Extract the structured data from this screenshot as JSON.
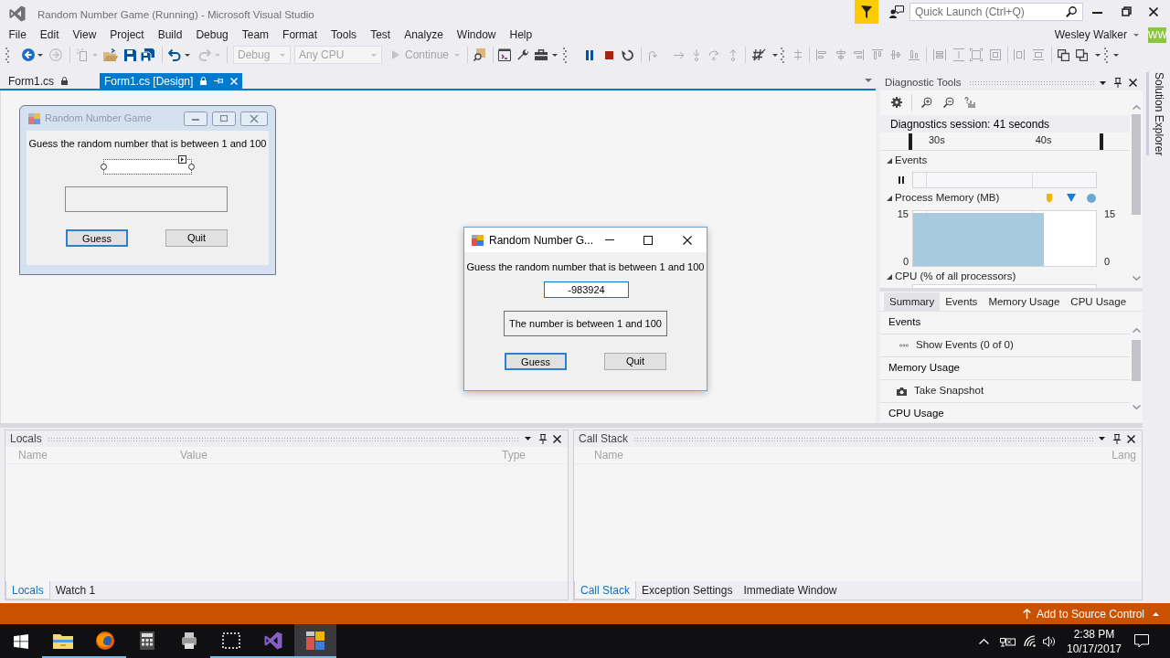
{
  "window": {
    "title": "Random Number Game (Running) - Microsoft Visual Studio",
    "quick_launch": {
      "placeholder": "Quick Launch (Ctrl+Q)"
    }
  },
  "menu": [
    "File",
    "Edit",
    "View",
    "Project",
    "Build",
    "Debug",
    "Team",
    "Format",
    "Tools",
    "Test",
    "Analyze",
    "Window",
    "Help"
  ],
  "account": {
    "name": "Wesley Walker",
    "initials": "WW"
  },
  "toolbar": {
    "configuration": {
      "value": "Debug",
      "disabled": true
    },
    "platform": {
      "value": "Any CPU",
      "disabled": true
    },
    "continue": {
      "label": "Continue",
      "disabled": true
    }
  },
  "document_tabs": [
    {
      "label": "Form1.cs",
      "selected": false
    },
    {
      "label": "Form1.cs [Design]",
      "selected": true
    }
  ],
  "designer_form": {
    "title": "Random Number Game",
    "prompt": "Guess the random number that is between 1 and 100",
    "buttons": [
      {
        "label": "Guess",
        "focused": true
      },
      {
        "label": "Quit",
        "focused": false
      }
    ]
  },
  "running_dialog": {
    "title": "Random Number G...",
    "prompt": "Guess the random number that is between 1 and 100",
    "input": "-983924",
    "message": "The number is between 1 and 100",
    "buttons": [
      {
        "label": "Guess",
        "focused": true
      },
      {
        "label": "Quit",
        "focused": false
      }
    ]
  },
  "diagnostic_tools": {
    "title": "Diagnostic Tools",
    "session": "Diagnostics session: 41 seconds",
    "timeline": [
      "30s",
      "40s"
    ],
    "events_label": "Events",
    "memory": {
      "label": "Process Memory (MB)",
      "left_axis": [
        "15",
        "0"
      ],
      "right_axis": [
        "15",
        "0"
      ]
    },
    "cpu_label": "CPU (% of all processors)",
    "tabs": [
      {
        "label": "Summary",
        "selected": true
      },
      {
        "label": "Events",
        "selected": false
      },
      {
        "label": "Memory Usage",
        "selected": false
      },
      {
        "label": "CPU Usage",
        "selected": false
      }
    ],
    "sections": [
      {
        "heading": "Events",
        "action": {
          "kind": "events",
          "label": "Show Events (0 of 0)"
        }
      },
      {
        "heading": "Memory Usage",
        "action": {
          "kind": "snapshot",
          "label": "Take Snapshot"
        }
      },
      {
        "heading": "CPU Usage"
      }
    ]
  },
  "side_tab": "Solution Explorer",
  "locals": {
    "title": "Locals",
    "columns": [
      "Name",
      "Value",
      "Type"
    ],
    "tabs": [
      {
        "label": "Locals",
        "selected": true
      },
      {
        "label": "Watch 1",
        "selected": false
      }
    ]
  },
  "call_stack": {
    "title": "Call Stack",
    "columns": [
      "Name",
      "Lang"
    ],
    "tabs": [
      {
        "label": "Call Stack",
        "selected": true
      },
      {
        "label": "Exception Settings",
        "selected": false
      },
      {
        "label": "Immediate Window",
        "selected": false
      }
    ]
  },
  "status_bar": {
    "source_control": "Add to Source Control"
  },
  "taskbar": {
    "apps": [
      {
        "kind": "explorer",
        "running": true,
        "selected": false
      },
      {
        "kind": "browser",
        "running": true,
        "selected": false
      },
      {
        "kind": "calculator",
        "running": false,
        "selected": false
      },
      {
        "kind": "app",
        "running": false,
        "selected": false
      },
      {
        "kind": "snipping",
        "running": true,
        "selected": false
      },
      {
        "kind": "visual_studio",
        "running": true,
        "selected": false
      },
      {
        "kind": "form_app",
        "running": true,
        "selected": true
      }
    ],
    "time": "2:38 PM",
    "date": "10/17/2017"
  }
}
